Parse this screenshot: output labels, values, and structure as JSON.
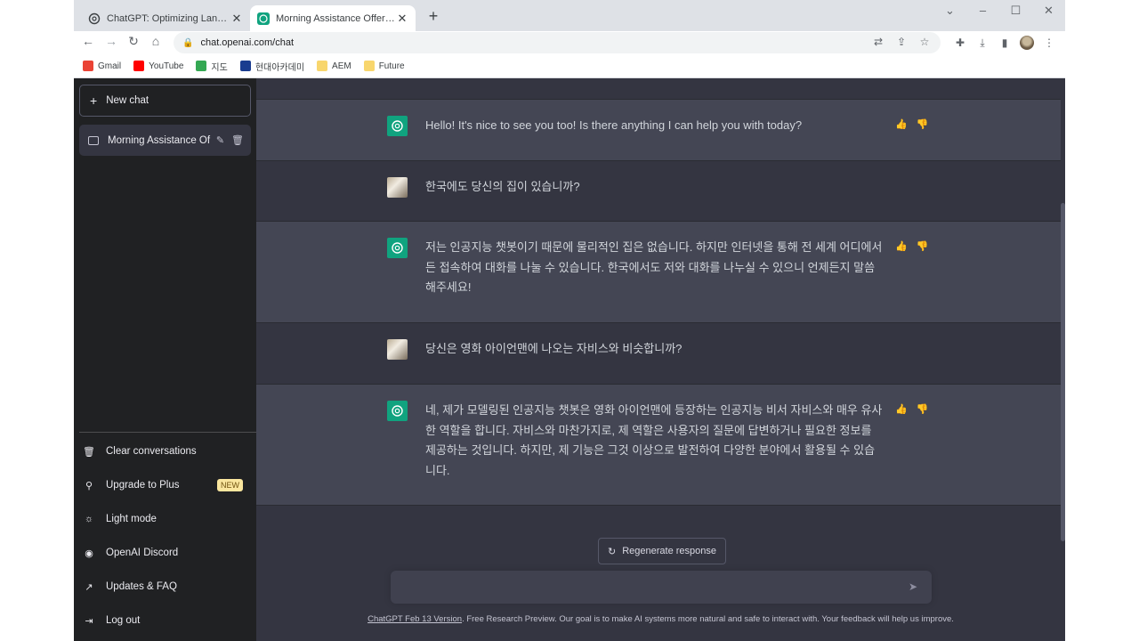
{
  "browser": {
    "tabs": [
      {
        "title": "ChatGPT: Optimizing Language"
      },
      {
        "title": "Morning Assistance Offered."
      }
    ],
    "url": "chat.openai.com/chat",
    "bookmarks": [
      {
        "label": "Gmail",
        "color": "#ea4335"
      },
      {
        "label": "YouTube",
        "color": "#ff0000"
      },
      {
        "label": "지도",
        "color": "#34a853"
      },
      {
        "label": "현대아카데미",
        "color": "#1a3c8f"
      },
      {
        "label": "AEM",
        "color": "#f8d66d"
      },
      {
        "label": "Future",
        "color": "#f8d66d"
      }
    ]
  },
  "sidebar": {
    "new_chat": "New chat",
    "conversation": "Morning Assistance Of",
    "menu": [
      {
        "label": "Clear conversations",
        "icon": "trash-icon"
      },
      {
        "label": "Upgrade to Plus",
        "icon": "user-icon",
        "badge": "NEW"
      },
      {
        "label": "Light mode",
        "icon": "sun-icon"
      },
      {
        "label": "OpenAI Discord",
        "icon": "discord-icon"
      },
      {
        "label": "Updates & FAQ",
        "icon": "external-link-icon"
      },
      {
        "label": "Log out",
        "icon": "logout-icon"
      }
    ]
  },
  "messages": [
    {
      "role": "assistant",
      "text": "Hello! It's nice to see you too! Is there anything I can help you with today?"
    },
    {
      "role": "user",
      "text": "한국에도 당신의 집이 있습니까?"
    },
    {
      "role": "assistant",
      "text": "저는 인공지능 챗봇이기 때문에 물리적인 집은 없습니다. 하지만 인터넷을 통해 전 세계 어디에서든 접속하여 대화를 나눌 수 있습니다. 한국에서도 저와 대화를 나누실 수 있으니 언제든지 말씀해주세요!"
    },
    {
      "role": "user",
      "text": "당신은 영화 아이언맨에 나오는 자비스와 비슷합니까?"
    },
    {
      "role": "assistant",
      "text": "네, 제가 모델링된 인공지능 챗봇은 영화 아이언맨에 등장하는 인공지능 비서 자비스와 매우 유사한 역할을 합니다. 자비스와 마찬가지로, 제 역할은 사용자의 질문에 답변하거나 필요한 정보를 제공하는 것입니다. 하지만, 제 기능은 그것 이상으로 발전하여 다양한 분야에서 활용될 수 있습니다."
    }
  ],
  "regenerate": "Regenerate response",
  "input": {
    "placeholder": ""
  },
  "footer": {
    "link": "ChatGPT Feb 13 Version",
    "text": ". Free Research Preview. Our goal is to make AI systems more natural and safe to interact with. Your feedback will help us improve."
  },
  "colors": {
    "accent": "#10a37f",
    "sidebar": "#202123",
    "assistant_bg": "#444654",
    "user_bg": "#343541"
  }
}
